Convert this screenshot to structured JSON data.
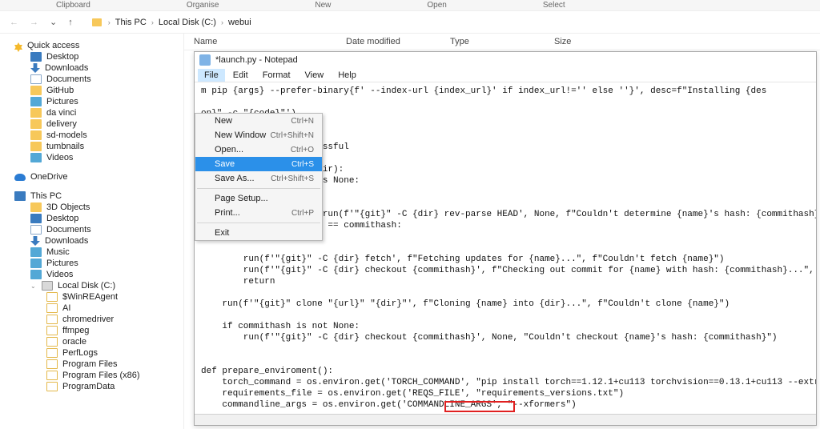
{
  "ribbon": {
    "clipboard": "Clipboard",
    "organise": "Organise",
    "new": "New",
    "open": "Open",
    "select": "Select"
  },
  "nav": {
    "crumbs": [
      "This PC",
      "Local Disk (C:)",
      "webui"
    ]
  },
  "columns": {
    "name": "Name",
    "date": "Date modified",
    "type": "Type",
    "size": "Size"
  },
  "sidebar": {
    "quick": {
      "label": "Quick access",
      "items": [
        "Desktop",
        "Downloads",
        "Documents",
        "GitHub",
        "Pictures",
        "da vinci",
        "delivery",
        "sd-models",
        "tumbnails",
        "Videos"
      ]
    },
    "onedrive": {
      "label": "OneDrive"
    },
    "thispc": {
      "label": "This PC",
      "items": [
        "3D Objects",
        "Desktop",
        "Documents",
        "Downloads",
        "Music",
        "Pictures",
        "Videos"
      ],
      "drive": {
        "label": "Local Disk (C:)",
        "items": [
          "$WinREAgent",
          "AI",
          "chromedriver",
          "ffmpeg",
          "oracle",
          "PerfLogs",
          "Program Files",
          "Program Files (x86)",
          "ProgramData"
        ]
      }
    }
  },
  "notepad": {
    "title": "*launch.py - Notepad",
    "menubar": [
      "File",
      "Edit",
      "Format",
      "View",
      "Help"
    ],
    "filemenu": [
      {
        "label": "New",
        "shortcut": "Ctrl+N"
      },
      {
        "label": "New Window",
        "shortcut": "Ctrl+Shift+N"
      },
      {
        "label": "Open...",
        "shortcut": "Ctrl+O"
      },
      {
        "label": "Save",
        "shortcut": "Ctrl+S",
        "selected": true
      },
      {
        "label": "Save As...",
        "shortcut": "Ctrl+Shift+S"
      },
      {
        "sep": true
      },
      {
        "label": "Page Setup...",
        "shortcut": ""
      },
      {
        "label": "Print...",
        "shortcut": "Ctrl+P"
      },
      {
        "sep": true
      },
      {
        "label": "Exit",
        "shortcut": ""
      }
    ],
    "code": "m pip {args} --prefer-binary{f' --index-url {index_url}' if index_url!='' else ''}', desc=f\"Installing {des\n\non}\" -c \"{code}\"')\n\n commithash=None):\ny dir and move if successful\n\n    if os.path.exists(dir):\n        if commithash is None:\n            return\n\n        current_hash = run(f'\"{git}\" -C {dir} rev-parse HEAD', None, f\"Couldn't determine {name}'s hash: {commithash}\").strip()\n        if current_hash == commithash:\n            return\n\n        run(f'\"{git}\" -C {dir} fetch', f\"Fetching updates for {name}...\", f\"Couldn't fetch {name}\")\n        run(f'\"{git}\" -C {dir} checkout {commithash}', f\"Checking out commit for {name} with hash: {commithash}...\", f\"Couldn't checkout\n        return\n\n    run(f'\"{git}\" clone \"{url}\" \"{dir}\"', f\"Cloning {name} into {dir}...\", f\"Couldn't clone {name}\")\n\n    if commithash is not None:\n        run(f'\"{git}\" -C {dir} checkout {commithash}', None, \"Couldn't checkout {name}'s hash: {commithash}\")\n\n\ndef prepare_enviroment():\n    torch_command = os.environ.get('TORCH_COMMAND', \"pip install torch==1.12.1+cu113 torchvision==0.13.1+cu113 --extra-index-url https:/\n    requirements_file = os.environ.get('REQS_FILE', \"requirements_versions.txt\")\n    commandline_args = os.environ.get('COMMANDLINE_ARGS', \"--xformers\")\n\n    gfpgan_package = os.environ.get('GFPGAN_PACKAGE', \"git+https://github.com/TencentARC/GFPGAN.git@8d2447a2d918f8eba5a4a01463fd48e45126\n    clip_package = os.environ.get('CLIP_PACKAGE', \"git+https://github.com/openai/CLIP.git@d50d76daa670286dd6cacf3bcd80b5e4823fc8e1\")"
  }
}
